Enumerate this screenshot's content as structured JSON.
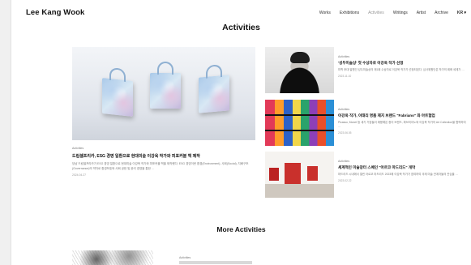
{
  "header": {
    "brand": "Lee Kang Wook",
    "nav": [
      "Works",
      "Exhibitions",
      "Activities",
      "Writings",
      "Artist",
      "Archive"
    ],
    "active_nav": "Activities",
    "lang": "KR"
  },
  "page_title": "Activities",
  "featured": {
    "category": "Activities",
    "title": "드림셀프리카, ESG 경영 일환으로 현대미술 이강욱 작가와 피포커블 백 제작",
    "description": "당남 드림셀프리카가 ESG 경영 일환으로 현대미술 이강욱 작가와 피포커블 백을 제작했다. ESG 경영이란 환경(Environment), 사회(Social), 지배구조(Governance)의 약자로 환경보호와 사회 공헌 및 윤리 경영을 통한 …",
    "date": "2024.04.27"
  },
  "list": [
    {
      "category": "Activities",
      "title": "'성두미술상' 첫 수상자로 이강욱 작가 선정",
      "description": "미학 후대 발원인 성두미술상의 제1회 수상자로 이강욱 작가가 선정되었다. 심사위원단은 작가의 회화 세계가 …",
      "date": "2023.11.10"
    },
    {
      "category": "Activities",
      "title": "이강욱 작가, 이태리 명품 제지 브랜드 \"Fabriano\" 와 아트협업",
      "description": "Picasso, Monet 등 세기 거장들이 애용해온 종이 브랜드, 파브리아노와 이강욱 작가의 Art Collection을 협력하여 …",
      "date": "2023.06.05"
    },
    {
      "category": "Activities",
      "title": "세계적인 미술장터 스페인 \"아르코 마드리드\" 개막",
      "description": "마드리드 시내에서 열린 아르코 마드리드 2023에 이강욱 작가가 참여하여 국제 미술 관계자들의 관심을 …",
      "date": "2023.02.22"
    }
  ],
  "more_title": "More Activities",
  "more_preview": {
    "category": "Activities"
  }
}
